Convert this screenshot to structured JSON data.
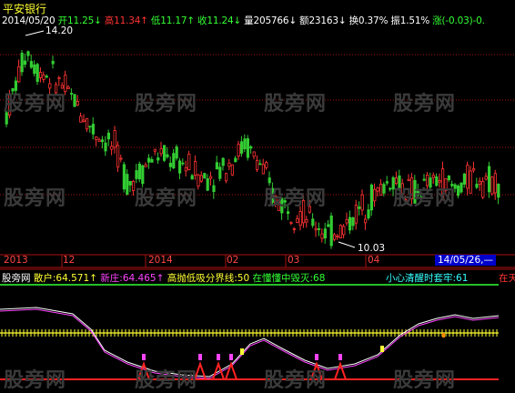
{
  "app": {
    "stock_name": "平安银行"
  },
  "quote": {
    "date": "2014/05/20",
    "open_label": "开",
    "open": "11.25",
    "open_dir": "↓",
    "high_label": "高",
    "high": "11.34",
    "high_dir": "↑",
    "low_label": "低",
    "low": "11.17",
    "low_dir": "↑",
    "close_label": "收",
    "close": "11.24",
    "close_dir": "↓",
    "volume_label": "量",
    "volume": "205766",
    "volume_dir": "↓",
    "amount_label": "额",
    "amount": "23163",
    "amount_dir": "↓",
    "turnover_label": "换",
    "turnover": "0.37%",
    "amplitude_label": "振",
    "amplitude": "1.51%",
    "change_label": "涨",
    "change": "(-0.03)",
    "change_tail": "-0."
  },
  "price_chart": {
    "high_marker": "14.20",
    "low_marker": "10.03"
  },
  "time_axis": {
    "labels": [
      "2013",
      "12",
      "2014",
      "02",
      "03",
      "04"
    ],
    "cursor_date": "14/05/26,—"
  },
  "indicator": {
    "name": "股旁网",
    "retail_label": "散户:",
    "retail_value": "64.571",
    "retail_dir": "↑",
    "new_dealer_label": "新庄:",
    "new_dealer_value": "64.465",
    "new_dealer_dir": "↑",
    "boundary_text": "高抛低吸分界线:50",
    "bailout_text": "在懂懂中毁灭:68",
    "caution_text": "小心清醒时套牢:61",
    "right_tail": "在天"
  },
  "watermark": "股旁网",
  "colors": {
    "background": "#000000",
    "up_candle": "#ff3333",
    "down_candle": "#33cc33",
    "grid": "#aa1111",
    "yellow_text": "#ffff33",
    "cyan_text": "#33ffff",
    "magenta": "#ff44ff",
    "green_text": "#33ff33",
    "red_line": "#ff2222",
    "white_line": "#ffffff"
  },
  "chart_data": {
    "type": "candlestick",
    "title": "平安银行",
    "x_axis_labels": [
      "2013",
      "12",
      "2014",
      "02",
      "03",
      "04"
    ],
    "price_high": 14.2,
    "price_low": 10.03,
    "last_bar": {
      "date": "2014/05/20",
      "open": 11.25,
      "high": 11.34,
      "low": 11.17,
      "close": 11.24
    },
    "indicator_levels": {
      "boundary": 50,
      "bailout": 68,
      "caution": 61
    },
    "indicator_values": {
      "retail": 64.571,
      "new_dealer": 64.465
    }
  }
}
